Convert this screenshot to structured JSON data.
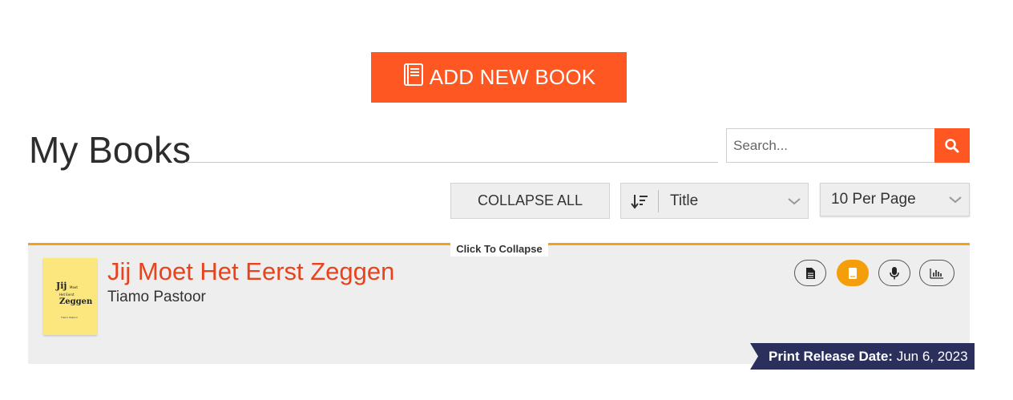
{
  "toolbar": {
    "add_book_label": "ADD NEW BOOK"
  },
  "page": {
    "title": "My Books"
  },
  "search": {
    "placeholder": "Search...",
    "value": ""
  },
  "controls": {
    "collapse_all_label": "COLLAPSE ALL",
    "sort_value": "Title",
    "per_page_value": "10 Per Page"
  },
  "books": [
    {
      "collapse_label": "Click To Collapse",
      "title": "Jij Moet Het Eerst Zeggen",
      "author": "Tiamo Pastoor",
      "cover_text": [
        "Jij",
        "Moet",
        "Het Eerst",
        "Zeggen",
        "Tiamo Pastoor"
      ],
      "actions": [
        {
          "icon": "document-icon",
          "active": false
        },
        {
          "icon": "book-icon",
          "active": true
        },
        {
          "icon": "microphone-icon",
          "active": false
        },
        {
          "icon": "stats-icon",
          "active": false
        }
      ],
      "release_label": "Print Release Date:",
      "release_date": "Jun 6, 2023"
    }
  ],
  "colors": {
    "accent": "#ff5722",
    "card_border": "#f0a31a",
    "title_red": "#e8431d",
    "active_action": "#f59e0b",
    "ribbon": "#2b2f5b"
  }
}
